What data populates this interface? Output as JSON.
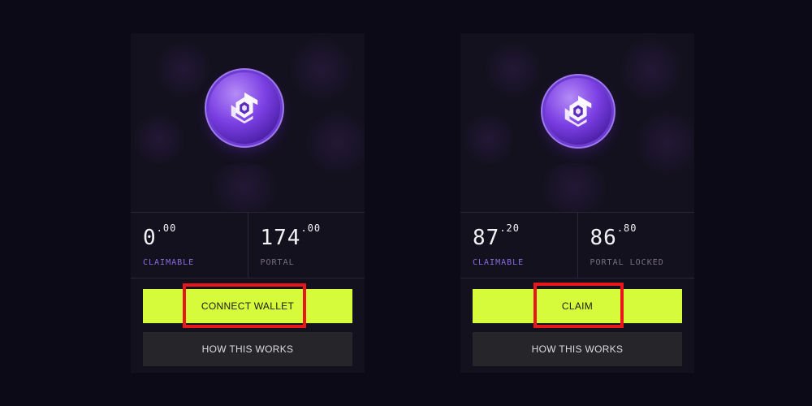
{
  "cards": [
    {
      "stats": [
        {
          "value_int": "0",
          "value_dec": ".00",
          "label": "CLAIMABLE"
        },
        {
          "value_int": "174",
          "value_dec": ".00",
          "label": "PORTAL"
        }
      ],
      "primary_button": "CONNECT WALLET",
      "secondary_button": "HOW THIS WORKS"
    },
    {
      "stats": [
        {
          "value_int": "87",
          "value_dec": ".20",
          "label": "CLAIMABLE"
        },
        {
          "value_int": "86",
          "value_dec": ".80",
          "label": "PORTAL LOCKED"
        }
      ],
      "primary_button": "CLAIM",
      "secondary_button": "HOW THIS WORKS"
    }
  ],
  "colors": {
    "accent_button": "#d6fb3a",
    "coin_purple": "#7b3fe3",
    "claimable_label": "#8a6ce0",
    "highlight": "#e8171b"
  },
  "icons": {
    "token": "portal-token-icon"
  }
}
